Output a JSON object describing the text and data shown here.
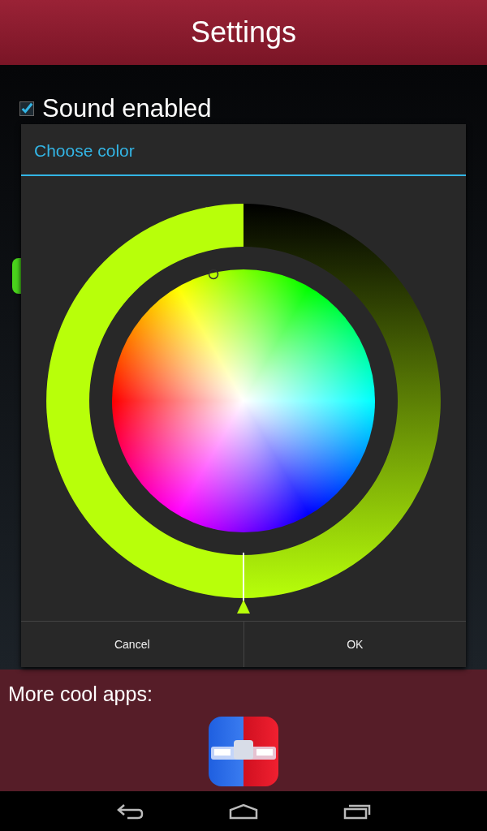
{
  "app_bar": {
    "title": "Settings"
  },
  "settings": {
    "sound": {
      "label": "Sound enabled",
      "checked": true
    }
  },
  "dialog": {
    "title": "Choose color",
    "color_picker": {
      "color": "#b8ff0a"
    },
    "buttons": [
      {
        "label": "Cancel"
      },
      {
        "label": "OK"
      }
    ]
  },
  "promo": {
    "heading": "More cool apps:"
  }
}
